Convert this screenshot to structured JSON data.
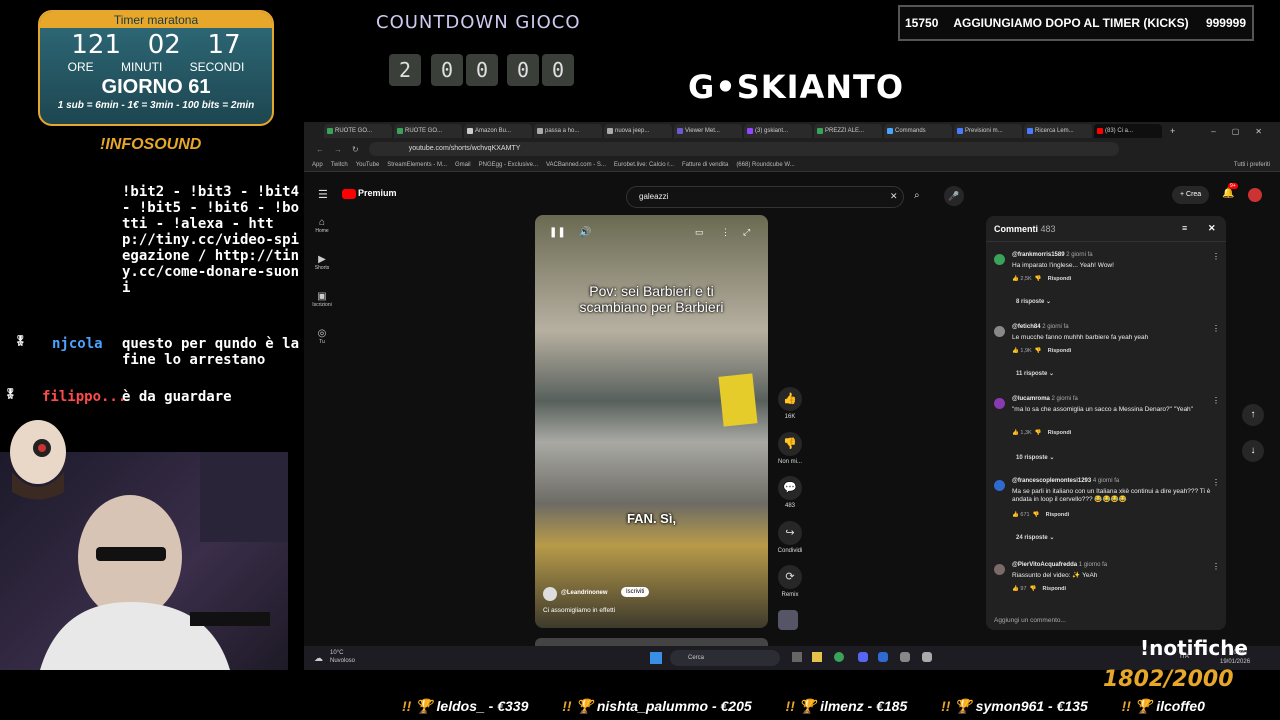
{
  "timer": {
    "title": "Timer maratona",
    "hours": "121",
    "minutes": "02",
    "seconds": "17",
    "label_hours": "ORE",
    "label_minutes": "MINUTI",
    "label_seconds": "SECONDI",
    "day": "GIORNO 61",
    "rates": "1 sub = 6min - 1€ = 3min - 100 bits = 2min"
  },
  "infosound": "!INFOSOUND",
  "chat": {
    "commands": "!bit2 - !bit3 - !bit4 - !bit5 - !bit6 - !botti - !alexa - http://tiny.cc/video-spiegazione / http://tiny.cc/come-donare-suoni",
    "msg1_user": "njcola",
    "msg1_text": "questo per qundo è la fine lo arrestano",
    "msg2_user": "filippo...",
    "msg2_text": "è da guardare"
  },
  "countdown": {
    "title": "COUNTDOWN GIOCO",
    "digits": [
      "2",
      "0",
      "0",
      "0",
      "0"
    ]
  },
  "logo": "G•SKIANTO",
  "goal": {
    "left": "15750",
    "text": "AGGIUNGIAMO DOPO AL TIMER (KICKS)",
    "right": "999999"
  },
  "browser": {
    "tabs": [
      "RUOTE GO...",
      "RUOTE GO...",
      "Amazon Bu...",
      "passa a ho...",
      "nuova jeep...",
      "Viewer Met...",
      "(3) gskiant...",
      "PREZZI ALE...",
      "Commands",
      "Previsioni m...",
      "Ricerca Lem...",
      "(83) Ci a..."
    ],
    "url": "youtube.com/shorts/wchvqKXAMTY",
    "bookmarks": [
      "App",
      "Twitch",
      "YouTube",
      "StreamElements - M...",
      "Gmail",
      "PNGEgg - Exclusive...",
      "VACBanned.com - S...",
      "Eurobet.live: Calcio r...",
      "Fatture di vendita",
      "(668) Roundcube W..."
    ],
    "search_value": "galeazzi",
    "premium": "Premium",
    "create": "+ Crea",
    "notif_badge": "9+",
    "sidebar": [
      "Home",
      "Shorts",
      "Iscrizioni",
      "Tu"
    ],
    "short_caption": "Pov: sei Barbieri e ti scambiano per Barbieri",
    "short_sub": "FAN. Sì,",
    "channel": "@Leandrinonew",
    "subscribe": "Iscriviti",
    "description": "Ci assomigliamo in effetti",
    "actions": [
      {
        "icon": "👍",
        "label": "16K"
      },
      {
        "icon": "👎",
        "label": "Non mi..."
      },
      {
        "icon": "💬",
        "label": "483"
      },
      {
        "icon": "↪",
        "label": "Condividi"
      },
      {
        "icon": "⟳",
        "label": "Remix"
      }
    ],
    "comments_title": "Commenti",
    "comments_count": "483",
    "comments": [
      {
        "user": "@frankmorris1589",
        "time": "2 giorni fa",
        "text": "Ha imparato l'inglese... Yeah! Wow!",
        "likes": "2,5K",
        "replies": "8 risposte",
        "color": "#3aa35a"
      },
      {
        "user": "@fetich84",
        "time": "2 giorni fa",
        "text": "Le mucche fanno muhhh barbiere fa yeah yeah",
        "likes": "1,9K",
        "replies": "11 risposte",
        "color": "#888888"
      },
      {
        "user": "@lucamroma",
        "time": "2 giorni fa",
        "text": "\"ma lo sa che assomiglia un sacco a Messina Denaro?\" \"Yeah\"",
        "likes": "1,3K",
        "replies": "10 risposte",
        "color": "#8a3ab0"
      },
      {
        "user": "@francescoplemontesi1293",
        "time": "4 giorni fa",
        "text": "Ma se parli in italiano con un Italiana xkè continui a dire yeah??? Ti è andata in loop il cervello??? 😂😂😂😂",
        "likes": "671",
        "replies": "24 risposte",
        "color": "#2f6ad0"
      },
      {
        "user": "@PierVitoAcquafredda",
        "time": "1 giorno fa",
        "text": "Riassunto del video: ✨ YeAh",
        "likes": "97",
        "replies": "",
        "color": "#7a6a6a"
      }
    ],
    "reply_label": "Rispondi",
    "add_comment": "Aggiungi un commento...",
    "weather_temp": "10°C",
    "weather_text": "Nuvoloso",
    "taskbar_search": "Cerca",
    "lang": "ITA",
    "time": "20:34",
    "date": "19/01/2026",
    "other_favorites": "Tutti i preferiti"
  },
  "notifiche": "!notifiche",
  "subcount": "1802/2000",
  "ticker": [
    "leldos_ - €339",
    "nishta_palummo - €205",
    "ilmenz - €185",
    "symon961 - €135",
    "ilcoffe0"
  ]
}
